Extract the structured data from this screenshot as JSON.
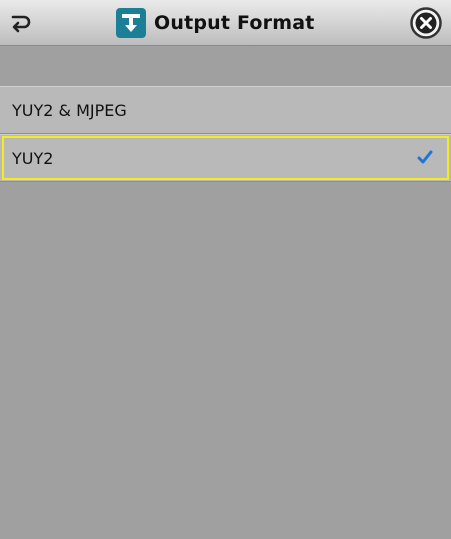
{
  "header": {
    "title": "Output Format",
    "back_icon": "return-arrow-icon",
    "app_icon": "output-format-icon",
    "close_icon": "close-x-icon"
  },
  "options": [
    {
      "label": "YUY2 & MJPEG",
      "selected": false
    },
    {
      "label": "YUY2",
      "selected": true
    }
  ],
  "colors": {
    "background": "#a0a0a0",
    "row": "#b9b9b9",
    "highlight": "#f3ec20",
    "check": "#1e74d8",
    "app_icon": "#1b7f96"
  }
}
